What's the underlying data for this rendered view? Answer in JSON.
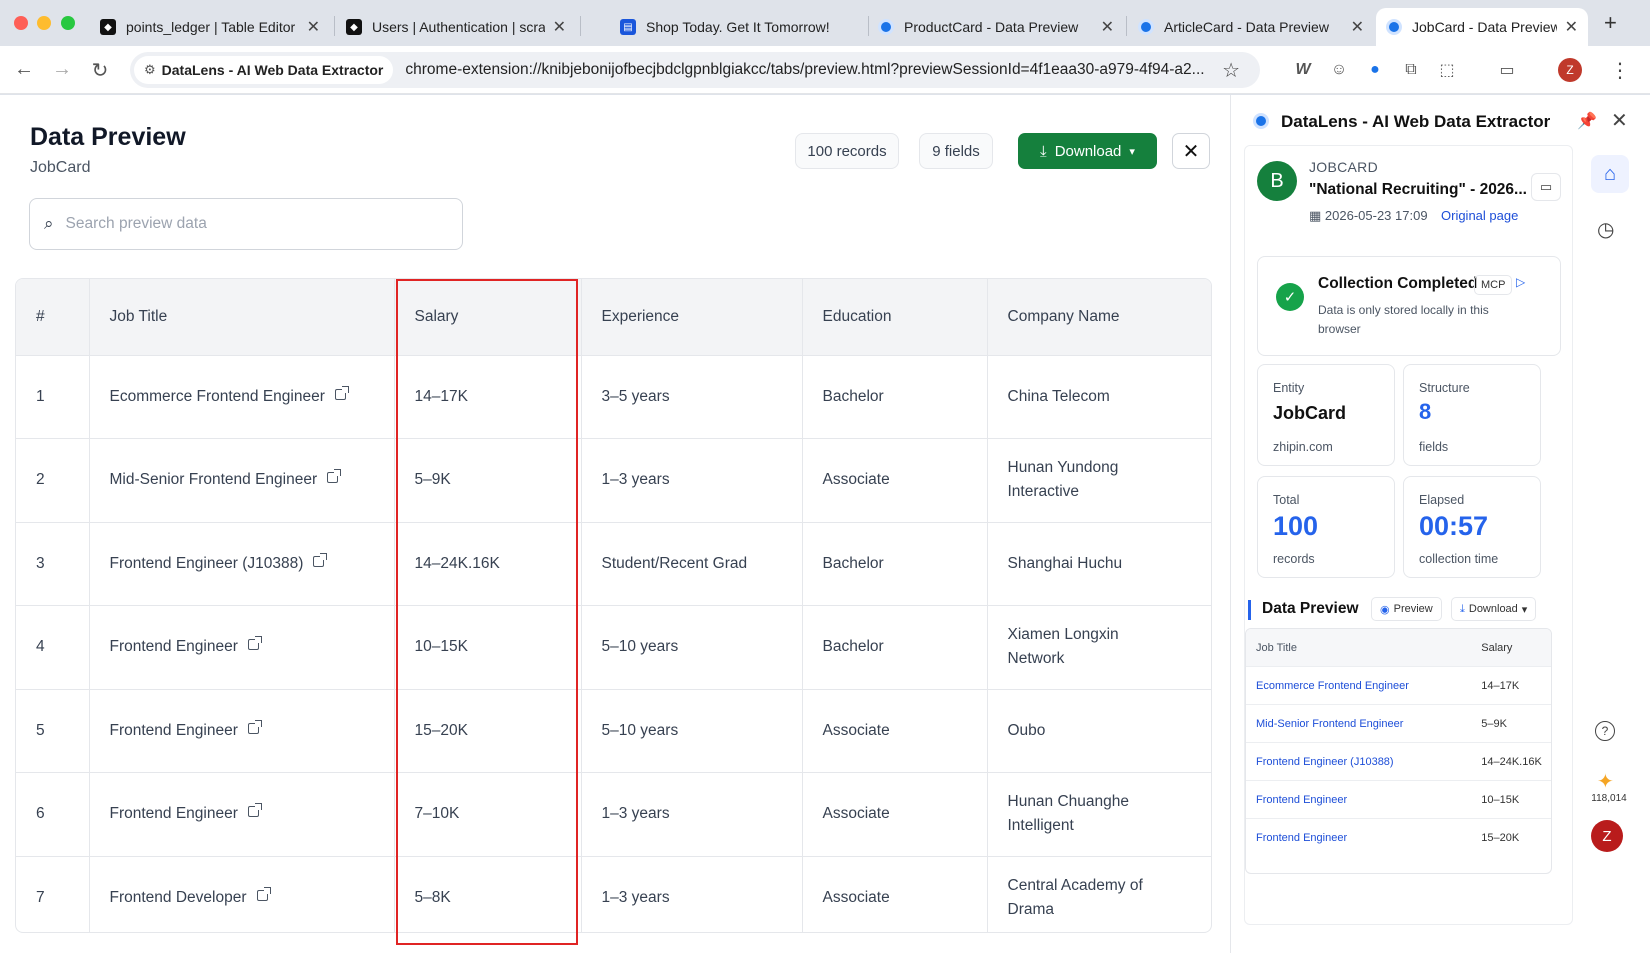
{
  "browser": {
    "tabs": [
      {
        "title": "points_ledger | Table Editor |",
        "favicon": "supabase-icon"
      },
      {
        "title": "Users | Authentication | scrap",
        "favicon": "supabase-icon"
      },
      {
        "title": "Shop Today. Get It Tomorrow!",
        "favicon": "document-icon"
      },
      {
        "title": "ProductCard - Data Preview",
        "favicon": "datalens-icon"
      },
      {
        "title": "ArticleCard - Data Preview",
        "favicon": "datalens-icon"
      },
      {
        "title": "JobCard - Data Preview",
        "favicon": "datalens-icon",
        "active": true
      }
    ],
    "site_chip": "DataLens - AI Web Data Extractor",
    "url": "chrome-extension://knibjebonijofbecjbdclgpnblgiakcc/tabs/preview.html?previewSessionId=4f1eaa30-a979-4f94-a2...",
    "profile_initial": "Z"
  },
  "main": {
    "title": "Data Preview",
    "subtitle": "JobCard",
    "records_pill": "100 records",
    "fields_pill": "9 fields",
    "download_label": "Download",
    "search_placeholder": "Search preview data",
    "columns": [
      "#",
      "Job Title",
      "Salary",
      "Experience",
      "Education",
      "Company Name"
    ],
    "rows": [
      {
        "n": "1",
        "title": "Ecommerce Frontend Engineer",
        "salary": "14–17K",
        "experience": "3–5 years",
        "education": "Bachelor",
        "company": "China Telecom"
      },
      {
        "n": "2",
        "title": "Mid-Senior Frontend Engineer",
        "salary": "5–9K",
        "experience": "1–3 years",
        "education": "Associate",
        "company": "Hunan Yundong Interactive"
      },
      {
        "n": "3",
        "title": "Frontend Engineer (J10388)",
        "salary": "14–24K.16K",
        "experience": "Student/Recent Grad",
        "education": "Bachelor",
        "company": "Shanghai Huchu"
      },
      {
        "n": "4",
        "title": "Frontend Engineer",
        "salary": "10–15K",
        "experience": "5–10 years",
        "education": "Bachelor",
        "company": "Xiamen Longxin Network"
      },
      {
        "n": "5",
        "title": "Frontend Engineer",
        "salary": "15–20K",
        "experience": "5–10 years",
        "education": "Associate",
        "company": "Oubo"
      },
      {
        "n": "6",
        "title": "Frontend Engineer",
        "salary": "7–10K",
        "experience": "1–3 years",
        "education": "Associate",
        "company": "Hunan Chuanghe Intelligent"
      },
      {
        "n": "7",
        "title": "Frontend Developer",
        "salary": "5–8K",
        "experience": "1–3 years",
        "education": "Associate",
        "company": "Central Academy of Drama"
      }
    ]
  },
  "panel": {
    "title": "DataLens - AI Web Data Extractor",
    "entity_initial": "B",
    "entity_kind": "JOBCARD",
    "entity_name": "\"National Recruiting\" - 2026...",
    "entity_date": "2026-05-23 17:09",
    "original_link": "Original page",
    "status_title": "Collection Completed",
    "status_badge": "MCP",
    "status_note": "Data is only stored locally in this browser",
    "stats": {
      "entity_label": "Entity",
      "entity_value": "JobCard",
      "entity_sub": "zhipin.com",
      "structure_label": "Structure",
      "structure_value": "8",
      "structure_sub": "fields",
      "total_label": "Total",
      "total_value": "100",
      "total_sub": "records",
      "elapsed_label": "Elapsed",
      "elapsed_value": "00:57",
      "elapsed_sub": "collection time"
    },
    "preview_title": "Data Preview",
    "preview_btn": "Preview",
    "download_btn": "Download",
    "mini_columns": [
      "Job Title",
      "Salary"
    ],
    "mini_rows": [
      {
        "title": "Ecommerce Frontend Engineer",
        "salary": "14–17K"
      },
      {
        "title": "Mid-Senior Frontend Engineer",
        "salary": "5–9K"
      },
      {
        "title": "Frontend Engineer (J10388)",
        "salary": "14–24K.16K"
      },
      {
        "title": "Frontend Engineer",
        "salary": "10–15K"
      },
      {
        "title": "Frontend Engineer",
        "salary": "15–20K"
      }
    ],
    "credits": "118,014",
    "profile_initial": "Z"
  },
  "colors": {
    "accent_green": "#15803d",
    "accent_blue": "#2563eb",
    "highlight_red": "#e02424"
  }
}
